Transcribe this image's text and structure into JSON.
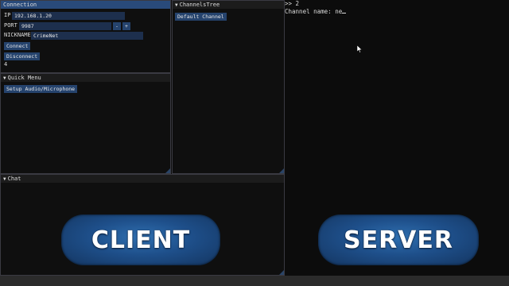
{
  "connection": {
    "title": "Connection",
    "ip_label": "IP",
    "ip_value": "192.168.1.20",
    "port_label": "PORT",
    "port_value": "9987",
    "minus": "-",
    "plus": "+",
    "nick_label": "NICKNAME",
    "nick_value": "CrimeNet",
    "connect": "Connect",
    "disconnect": "Disconnect",
    "status_value": "4"
  },
  "quick_menu": {
    "title": "Quick Menu",
    "setup_audio": "Setup Audio/Microphone"
  },
  "channels_tree": {
    "title": "ChannelsTree",
    "default_channel": "Default Channel"
  },
  "chat": {
    "title": "Chat"
  },
  "console": {
    "line1": ">> 2",
    "line2": "Channel name: ne"
  },
  "badges": {
    "client": "CLIENT",
    "server": "SERVER"
  },
  "icons": {
    "collapse": "triangle-down-icon",
    "resize": "resize-grip-icon"
  },
  "colors": {
    "accent": "#294a7a",
    "button": "#25436d",
    "field": "#1d2f4d",
    "badge": "#1e4f8a"
  }
}
